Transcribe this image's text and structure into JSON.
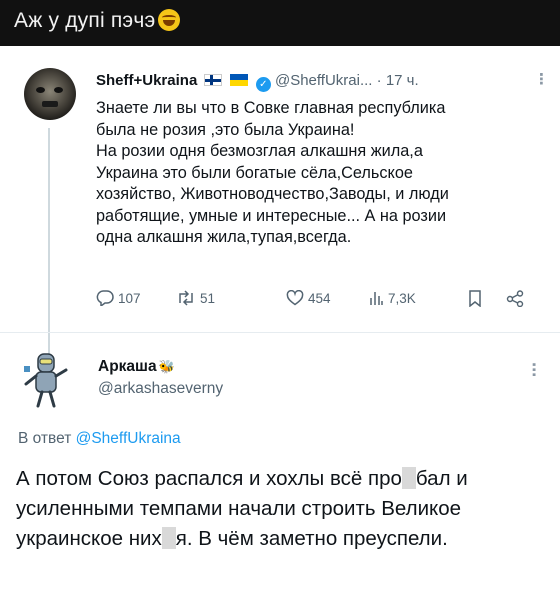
{
  "caption": {
    "text": "Аж у дупі пэчэ"
  },
  "tweet_main": {
    "author_name": "Sheff+Ukraina",
    "handle": "@SheffUkrai...",
    "separator": "·",
    "time": "17 ч.",
    "text": "Знаете ли вы что в Совке главная республика\nбыла не розия ,это была Украина!\nНа розии одня безмозглая алкашня жила,а\nУкраина это были богатые сёла,Сельское\nхозяйство, Животноводчество,Заводы, и люди\nработящие, умные и интересные... А на розии\nодна алкашня жила,тупая,всегда.",
    "replies": "107",
    "retweets": "51",
    "likes": "454",
    "views": "7,3K"
  },
  "tweet_reply": {
    "author_name": "Аркаша",
    "handle": "@arkashaseverny",
    "reply_label": "В ответ",
    "reply_to": "@SheffUkraina",
    "text_part1": "А потом Союз распался и хохлы всё про",
    "text_part2": "бал и усиленными темпами начали строить Великое украинское них",
    "text_part3": "я. В чём заметно преуспели."
  },
  "colors": {
    "link": "#1d9bf0",
    "secondary_text": "#536471",
    "verified": "#1d9bf0"
  },
  "icons": [
    "reply-icon",
    "retweet-icon",
    "like-icon",
    "views-icon",
    "bookmark-icon",
    "share-icon",
    "verified-icon",
    "more-icon"
  ]
}
